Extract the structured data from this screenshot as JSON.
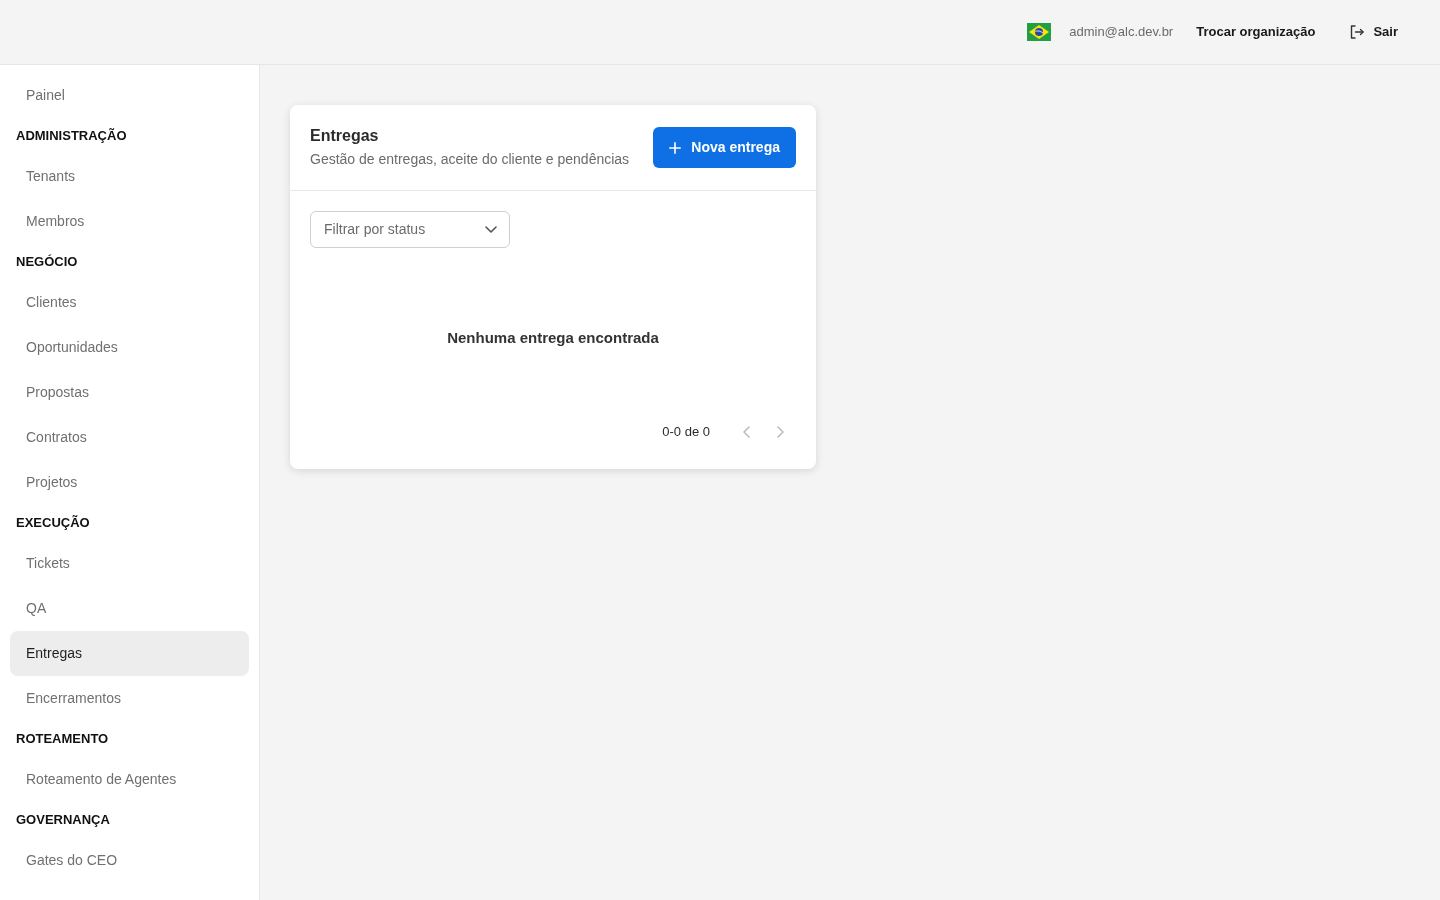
{
  "header": {
    "user_email": "admin@alc.dev.br",
    "switch_org_label": "Trocar organização",
    "logout_label": "Sair"
  },
  "sidebar": {
    "items": [
      {
        "label": "Painel",
        "selected": false
      }
    ],
    "sections": [
      {
        "title": "ADMINISTRAÇÃO",
        "items": [
          {
            "label": "Tenants",
            "selected": false
          },
          {
            "label": "Membros",
            "selected": false
          }
        ]
      },
      {
        "title": "NEGÓCIO",
        "items": [
          {
            "label": "Clientes",
            "selected": false
          },
          {
            "label": "Oportunidades",
            "selected": false
          },
          {
            "label": "Propostas",
            "selected": false
          },
          {
            "label": "Contratos",
            "selected": false
          },
          {
            "label": "Projetos",
            "selected": false
          }
        ]
      },
      {
        "title": "EXECUÇÃO",
        "items": [
          {
            "label": "Tickets",
            "selected": false
          },
          {
            "label": "QA",
            "selected": false
          },
          {
            "label": "Entregas",
            "selected": true
          },
          {
            "label": "Encerramentos",
            "selected": false
          }
        ]
      },
      {
        "title": "ROTEAMENTO",
        "items": [
          {
            "label": "Roteamento de Agentes",
            "selected": false
          }
        ]
      },
      {
        "title": "GOVERNANÇA",
        "items": [
          {
            "label": "Gates do CEO",
            "selected": false
          }
        ]
      }
    ]
  },
  "card": {
    "title": "Entregas",
    "subtitle": "Gestão de entregas, aceite do cliente e pendências",
    "primary_button": {
      "label": "Nova entrega"
    },
    "status_filter": {
      "placeholder": "Filtrar por status"
    },
    "empty_message": "Nenhuma entrega encontrada",
    "pagination": {
      "range": "0-0 de 0",
      "previous_disabled": true,
      "next_disabled": true
    }
  }
}
